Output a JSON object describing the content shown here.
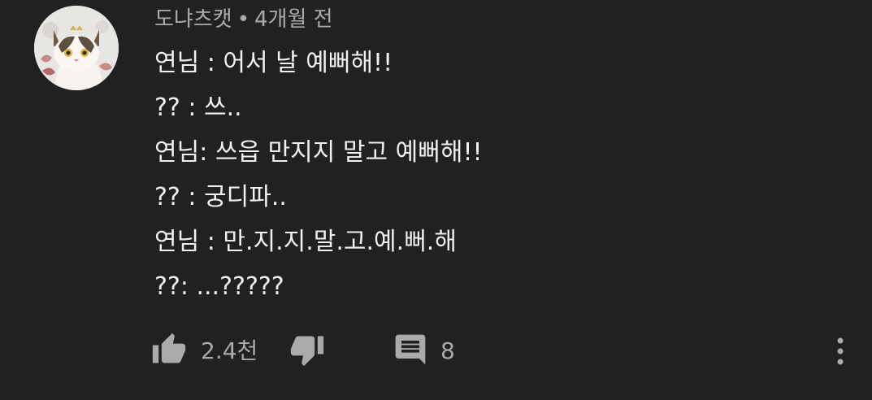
{
  "comment": {
    "author": "도냐츠캣",
    "separator": "•",
    "time": "4개월 전",
    "lines": [
      "연님 : 어서 날 예뻐해!!",
      "?? : 쓰..",
      "연님: 쓰읍 만지지 말고 예뻐해!!",
      "?? : 궁디파..",
      "연님 : 만.지.지.말.고.예.뻐.해",
      "??: ...?????"
    ],
    "avatar_icon": "cat-avatar-icon"
  },
  "actions": {
    "like_icon": "thumbs-up-icon",
    "like_count": "2.4천",
    "dislike_icon": "thumbs-down-icon",
    "reply_icon": "comment-icon",
    "reply_count": "8",
    "more_icon": "more-vertical-icon"
  },
  "colors": {
    "background": "#212121",
    "primary_text": "#f1f1f1",
    "secondary_text": "#aaaaaa",
    "icon": "#aaaaaa"
  }
}
